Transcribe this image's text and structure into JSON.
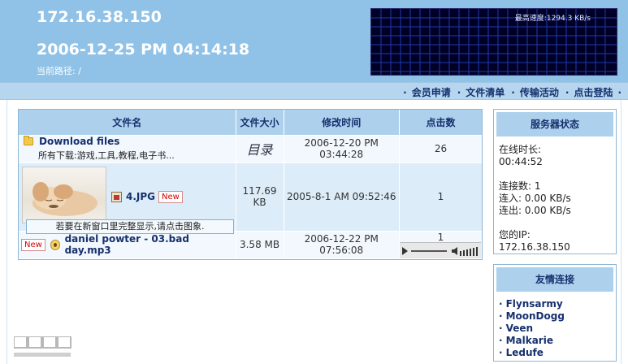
{
  "header": {
    "ip": "172.16.38.150",
    "datetime": "2006-12-25 PM 04:14:18",
    "path_label": "当前路径:",
    "path_value": "/",
    "speed_label": "最高速度:",
    "speed_value": "1294.3 KB/s"
  },
  "nav": {
    "items": [
      "会员申请",
      "文件清单",
      "传输活动",
      "点击登陆"
    ]
  },
  "table": {
    "headers": [
      "文件名",
      "文件大小",
      "修改时间",
      "点击数"
    ],
    "rows": [
      {
        "name": "Download files",
        "desc": "所有下载:游戏,工具,教程,电子书...",
        "size": "目录",
        "modified": "2006-12-20 PM 03:44:28",
        "hits": "26"
      },
      {
        "name": "4.JPG",
        "badge": "New",
        "tooltip": "若要在新窗口里完整显示,请点击图象.",
        "size": "117.69 KB",
        "modified": "2005-8-1 AM 09:52:46",
        "hits": "1"
      },
      {
        "name": "daniel powter - 03.bad day.mp3",
        "badge": "New",
        "size": "3.58 MB",
        "modified": "2006-12-22 PM 07:56:08",
        "hits": "1"
      }
    ]
  },
  "server": {
    "title": "服务器状态",
    "online_label": "在线时长:",
    "online_value": "00:44:52",
    "connections": "连接数: 1",
    "in_rate": "连入: 0.00 KB/s",
    "out_rate": "连出: 0.00 KB/s",
    "ip_label": "您的IP:",
    "ip_value": "172.16.38.150"
  },
  "links": {
    "title": "友情连接",
    "items": [
      "Flynsarmy",
      "MoonDogg",
      "Veen",
      "Malkarie",
      "Ledufe"
    ]
  },
  "colors": {
    "header_bg": "#8fc2e6",
    "nav_bg": "#b5d6ee",
    "table_header_bg": "#add1ec",
    "link_text": "#16306e",
    "badge_red": "#d40000",
    "graph_bg": "#000026"
  }
}
